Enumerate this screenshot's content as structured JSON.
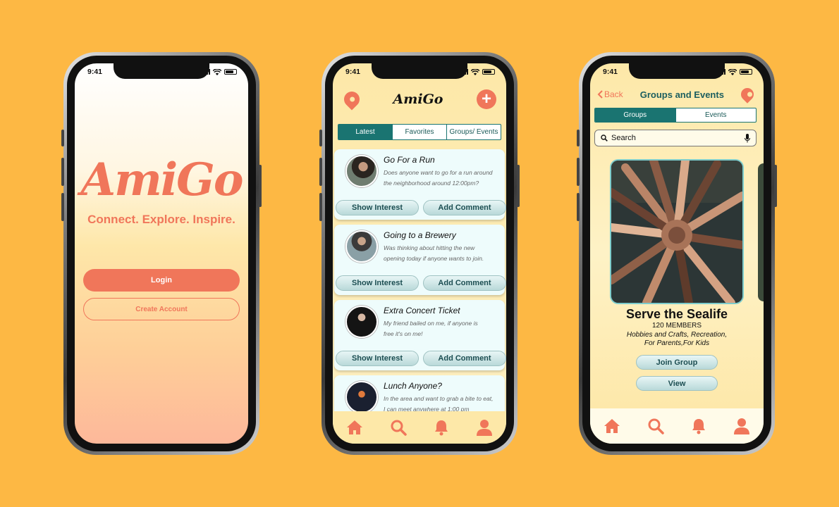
{
  "status_time": "9:41",
  "colors": {
    "background": "#fdb844",
    "accent": "#f0765a",
    "teal": "#1a7471"
  },
  "login_screen": {
    "logo": "AmiGo",
    "tagline": "Connect. Explore. Inspire.",
    "login_label": "Login",
    "create_account_label": "Create Account"
  },
  "feed_screen": {
    "logo": "AmiGo",
    "left_icon": "location-pin-icon",
    "right_icon": "add-circle-icon",
    "tabs": [
      {
        "label": "Latest",
        "active": true
      },
      {
        "label": "Favorites",
        "active": false
      },
      {
        "label": "Groups/ Events",
        "active": false
      }
    ],
    "posts": [
      {
        "title": "Go For a Run",
        "desc_1": "Does anyone want to go for a run around",
        "desc_2": "the neighborhood around 12:00pm?",
        "interest": "Show Interest",
        "comment": "Add Comment"
      },
      {
        "title": "Going to a Brewery",
        "desc_1": "Was thinking about hitting the new",
        "desc_2": "opening today if anyone wants to join.",
        "interest": "Show Interest",
        "comment": "Add Comment"
      },
      {
        "title": "Extra Concert Ticket",
        "desc_1": "My friend bailed on me, if anyone is",
        "desc_2": "free it's on me!",
        "interest": "Show Interest",
        "comment": "Add Comment"
      },
      {
        "title": "Lunch Anyone?",
        "desc_1": "In the area and want to grab a bite to eat,",
        "desc_2": "I can meet anywhere at 1:00 pm",
        "interest": "",
        "comment": ""
      }
    ],
    "tabbar_icons": [
      "home-icon",
      "search-icon",
      "bell-icon",
      "profile-icon"
    ]
  },
  "groups_screen": {
    "back_label": "Back",
    "title": "Groups and Events",
    "tabs": [
      {
        "label": "Groups",
        "active": true
      },
      {
        "label": "Events",
        "active": false
      }
    ],
    "search_placeholder": "Search",
    "group": {
      "name": "Serve the Sealife",
      "members": "120 MEMBERS",
      "categories_1": "Hobbies and Crafts, Recreation,",
      "categories_2": "For Parents,For Kids",
      "join_label": "Join Group",
      "view_label": "View"
    },
    "tabbar_icons": [
      "home-icon",
      "search-icon",
      "bell-icon",
      "profile-icon"
    ]
  }
}
